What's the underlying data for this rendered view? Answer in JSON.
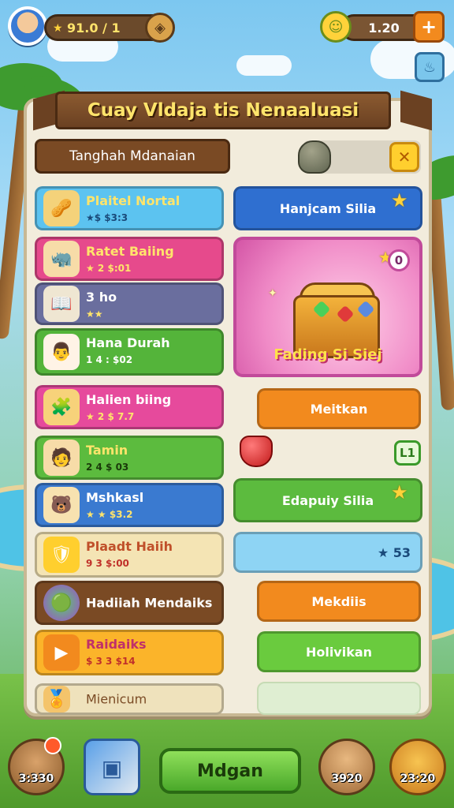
{
  "topbar": {
    "currency_left": "91.0 / 1",
    "currency_right": "1.20",
    "icons": [
      "avatar",
      "coin-icon",
      "swap-icon",
      "sun-icon",
      "plus-icon",
      "lamp-icon"
    ]
  },
  "panel": {
    "title": "Cuay Vldaja tis Nenaaluasi",
    "search_label": "Tanghah Mdanaian"
  },
  "left_items": [
    {
      "name": "Plaitel Nortal",
      "sub": "★$ $3:3",
      "color": "#5cc3f0",
      "icon": "basket-icon",
      "glyph": "🥜"
    },
    {
      "name": "Ratet Baiing",
      "sub": "★ 2 $:01",
      "color": "#e64a8c",
      "icon": "character-icon",
      "glyph": "🦏"
    },
    {
      "name": "3 ho",
      "sub": "★★",
      "color": "#6a6e9e",
      "icon": "book-icon",
      "glyph": "📖"
    },
    {
      "name": "Hana Durah",
      "sub": "1 4 : $02",
      "color": "#54b43a",
      "icon": "chef-icon",
      "glyph": "👨"
    },
    {
      "name": "Halien biing",
      "sub": "★ 2 $ 7.7",
      "color": "#e64a9c",
      "icon": "treasure-icon",
      "glyph": "🧩"
    },
    {
      "name": "Tamin",
      "sub": "2 4 $ 03",
      "color": "#5cbb3e",
      "icon": "person-icon",
      "glyph": "🧑"
    },
    {
      "name": "Mshkasl",
      "sub": "★ ★ $3.2",
      "color": "#3a7ad0",
      "icon": "pet-icon",
      "glyph": "🐻"
    },
    {
      "name": "Plaadt Haiih",
      "sub": "9 3 $:00",
      "color": "#f4e4b4",
      "icon": "shield-icon",
      "glyph": "🛡"
    },
    {
      "name": "Hadiiah Mendaiks",
      "sub": "",
      "color": "#7a4a24",
      "icon": "orb-icon",
      "glyph": "🟢"
    },
    {
      "name": "Raidaiks",
      "sub": "$ 3 3 $14",
      "color": "#fbb42a",
      "icon": "play-icon",
      "glyph": "▶"
    },
    {
      "name": "Mienicum",
      "sub": "",
      "color": "#efe2bc",
      "icon": "badge-icon",
      "glyph": "🏅"
    }
  ],
  "right_items": {
    "hanjcam": "Hanjcam Silia",
    "chest_label": "Fading Si Siej",
    "chest_badge": "0",
    "meitkan": "Meitkan",
    "l1_badge": "L1",
    "edapuiy": "Edapuiy Silia",
    "star_value": "★ 53",
    "mekdiis": "Mekdiis",
    "holivikan": "Holivikan"
  },
  "bottom": {
    "left_value": "3:330",
    "center_label": "Mdgan",
    "bear_value": "3920",
    "right_value": "23:20"
  }
}
